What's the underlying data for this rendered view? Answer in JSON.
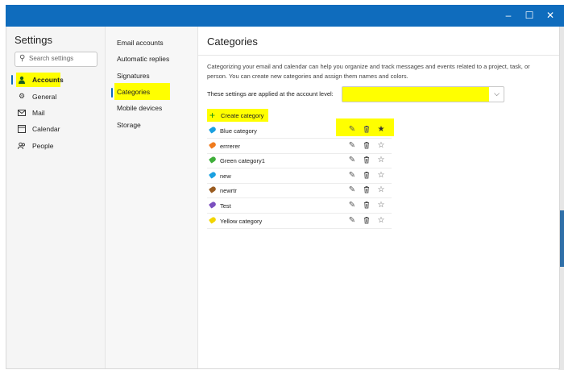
{
  "titlebar": {
    "minimize": "–",
    "maximize": "☐",
    "close": "✕"
  },
  "sidebar": {
    "title": "Settings",
    "search_placeholder": "Search settings",
    "items": [
      {
        "label": "Accounts",
        "icon": "person-icon"
      },
      {
        "label": "General",
        "icon": "gear-icon"
      },
      {
        "label": "Mail",
        "icon": "mail-icon"
      },
      {
        "label": "Calendar",
        "icon": "calendar-icon"
      },
      {
        "label": "People",
        "icon": "people-icon"
      }
    ]
  },
  "subnav": {
    "items": [
      {
        "label": "Email accounts"
      },
      {
        "label": "Automatic replies"
      },
      {
        "label": "Signatures"
      },
      {
        "label": "Categories"
      },
      {
        "label": "Mobile devices"
      },
      {
        "label": "Storage"
      }
    ]
  },
  "main": {
    "title": "Categories",
    "description": "Categorizing your email and calendar can help you organize and track messages and events related to a project, task, or person. You can create new categories and assign them names and colors.",
    "account_label": "These settings are applied at the account level:",
    "account_value": "",
    "create_label": "Create category",
    "categories": [
      {
        "name": "Blue category",
        "color": "#1aa0e0",
        "favorite": true
      },
      {
        "name": "errrerer",
        "color": "#f07b1d",
        "favorite": false
      },
      {
        "name": "Green category1",
        "color": "#3fae3a",
        "favorite": false
      },
      {
        "name": "new",
        "color": "#1aa0e0",
        "favorite": false
      },
      {
        "name": "newrtr",
        "color": "#9a5c21",
        "favorite": false
      },
      {
        "name": "Test",
        "color": "#7b4fbf",
        "favorite": false
      },
      {
        "name": "Yellow category",
        "color": "#f2d500",
        "favorite": false
      }
    ]
  },
  "colors": {
    "accent": "#0f6cbd",
    "highlight": "#ffff00"
  }
}
